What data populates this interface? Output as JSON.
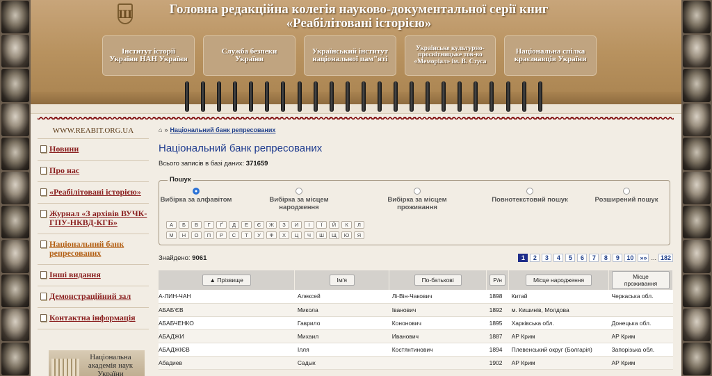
{
  "header": {
    "title_line1": "Головна редакційна колегія науково-документальної серії книг",
    "title_line2": "«Реабілітовані історією»",
    "partners": [
      "Інститут історії України НАН України",
      "Служба безпеки України",
      "Український інститут національної пам\"яті",
      "Українське культурно-просвітницьке тов-во «Меморіал» ім. В. Стуса",
      "Національна спілка краєзнавців України"
    ]
  },
  "sidebar": {
    "site_url": "WWW.REABIT.ORG.UA",
    "items": [
      {
        "label": "Новини",
        "active": false
      },
      {
        "label": "Про нас",
        "active": false
      },
      {
        "label": "«Реабілітовані історією»",
        "active": false
      },
      {
        "label": "Журнал «З архівів ВУЧК-ГПУ-НКВД-КГБ»",
        "active": false
      },
      {
        "label": "Національний банк репресованих",
        "active": true
      },
      {
        "label": "Інші видання",
        "active": false
      },
      {
        "label": "Демонстраційний зал",
        "active": false
      },
      {
        "label": "Контактна інформація",
        "active": false
      }
    ],
    "academy_text": "Національна академія наук України"
  },
  "main": {
    "breadcrumb_home_icon": "home-icon",
    "breadcrumb_separator": "»",
    "breadcrumb_link": "Національний банк репресованих",
    "title": "Національний банк репресованих",
    "total_label": "Всього записів в базі даних:",
    "total_value": "371659",
    "search": {
      "legend": "Пошук",
      "options": [
        {
          "label": "Вибірка за алфавітом",
          "checked": true
        },
        {
          "label": "Вибірка за місцем народження",
          "checked": false
        },
        {
          "label": "Вибірка за місцем проживання",
          "checked": false
        },
        {
          "label": "Повнотекстовий пошук",
          "checked": false
        },
        {
          "label": "Розширений пошук",
          "checked": false
        }
      ],
      "letters_row1": [
        "А",
        "Б",
        "В",
        "Г",
        "Ґ",
        "Д",
        "Е",
        "Є",
        "Ж",
        "З",
        "И",
        "І",
        "Ї",
        "Й",
        "К",
        "Л"
      ],
      "letters_row2": [
        "М",
        "Н",
        "О",
        "П",
        "Р",
        "С",
        "Т",
        "У",
        "Ф",
        "Х",
        "Ц",
        "Ч",
        "Ш",
        "Щ",
        "Ю",
        "Я"
      ]
    },
    "found_label": "Знайдено:",
    "found_value": "9061",
    "pager": {
      "current": "1",
      "pages": [
        "2",
        "3",
        "4",
        "5",
        "6",
        "7",
        "8",
        "9",
        "10"
      ],
      "next": "»»",
      "ellipsis": "...",
      "last": "182"
    },
    "table": {
      "columns": [
        "▲ Прізвище",
        "Ім'я",
        "По-батькові",
        "Р/н",
        "Місце народження",
        "Місце проживання"
      ],
      "rows": [
        [
          "А-ЛИН-ЧАН",
          "Алексей",
          "Лі-Він-Чакович",
          "1898",
          "Китай",
          "Черкаська обл."
        ],
        [
          "АБАБ'ЄВ",
          "Микола",
          "Іванович",
          "1892",
          "м. Кишинів, Молдова",
          ""
        ],
        [
          "АБАБЧЕНКО",
          "Гаврило",
          "Кононович",
          "1895",
          "Харківська обл.",
          "Донецька обл."
        ],
        [
          "АБАДЖИ",
          "Михаил",
          "Иванович",
          "1887",
          "АР Крим",
          "АР Крим"
        ],
        [
          "АБАДЖІЄВ",
          "Ілля",
          "Костянтинович",
          "1894",
          "Плевенський округ (Болгарія)",
          "Запорізька обл."
        ],
        [
          "Абадиев",
          "Садык",
          "",
          "1902",
          "АР Крим",
          "АР Крим"
        ]
      ]
    }
  }
}
